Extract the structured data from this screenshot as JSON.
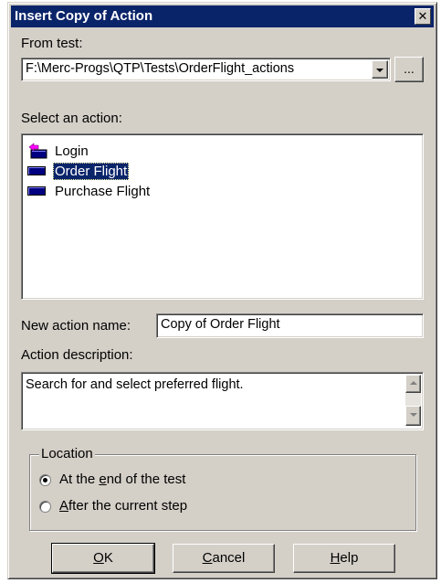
{
  "window": {
    "title": "Insert Copy of Action",
    "close_glyph": "✕"
  },
  "from_test": {
    "label": "From test:",
    "value": "F:\\Merc-Progs\\QTP\\Tests\\OrderFlight_actions",
    "browse_label": "..."
  },
  "actions": {
    "label": "Select an action:",
    "items": [
      {
        "label": "Login",
        "icon": "reusable-action-icon",
        "selected": false
      },
      {
        "label": "Order Flight",
        "icon": "action-icon",
        "selected": true
      },
      {
        "label": "Purchase Flight",
        "icon": "action-icon",
        "selected": false
      }
    ]
  },
  "new_action": {
    "label": "New action name:",
    "value": "Copy of Order Flight"
  },
  "description": {
    "label": "Action description:",
    "value": "Search for and select preferred flight."
  },
  "location": {
    "legend": "Location",
    "options": [
      {
        "pre": "At the ",
        "accel": "e",
        "post": "nd of the test",
        "checked": true
      },
      {
        "pre": "",
        "accel": "A",
        "post": "fter the current step",
        "checked": false
      }
    ]
  },
  "buttons": {
    "ok": {
      "accel": "O",
      "rest": "K"
    },
    "cancel": {
      "accel": "C",
      "rest": "ancel"
    },
    "help": {
      "accel": "H",
      "rest": "elp"
    }
  },
  "colors": {
    "title_bar": "#0a246a",
    "face": "#d4d0c8",
    "selection": "#0a246a"
  }
}
